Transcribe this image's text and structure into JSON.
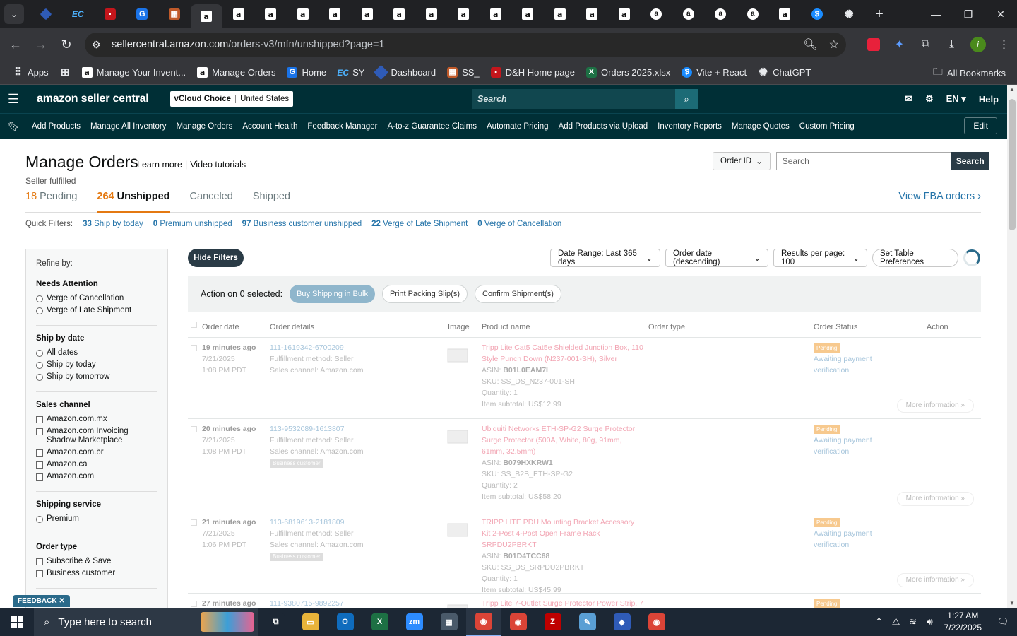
{
  "browser": {
    "tabs": [
      {
        "icon": "blue-diamond-icon"
      },
      {
        "icon": "ec-icon"
      },
      {
        "icon": "dh-icon"
      },
      {
        "icon": "g-icon"
      },
      {
        "icon": "box-icon"
      },
      {
        "icon": "amazon-icon",
        "active": true
      },
      {
        "icon": "amazon-icon"
      },
      {
        "icon": "amazon-icon"
      },
      {
        "icon": "amazon-icon"
      },
      {
        "icon": "amazon-icon"
      },
      {
        "icon": "amazon-icon"
      },
      {
        "icon": "amazon-icon"
      },
      {
        "icon": "amazon-icon"
      },
      {
        "icon": "amazon-icon"
      },
      {
        "icon": "amazon-icon"
      },
      {
        "icon": "amazon-icon"
      },
      {
        "icon": "amazon-icon"
      },
      {
        "icon": "amazon-icon"
      },
      {
        "icon": "amazon-icon"
      },
      {
        "icon": "amazon-circle-icon"
      },
      {
        "icon": "amazon-circle-icon"
      },
      {
        "icon": "amazon-circle-icon"
      },
      {
        "icon": "amazon-circle-icon"
      },
      {
        "icon": "amazon-icon"
      },
      {
        "icon": "s-icon"
      },
      {
        "icon": "chatgpt-icon"
      }
    ],
    "url_domain": "sellercentral.amazon.com",
    "url_path": "/orders-v3/mfn/unshipped?page=1",
    "bookmarks": [
      {
        "label": "Apps",
        "icon": "apps-grid-icon"
      },
      {
        "label": "",
        "icon": "tab-groups-icon"
      },
      {
        "label": "Manage Your Invent...",
        "icon": "amazon-icon"
      },
      {
        "label": "Manage Orders",
        "icon": "amazon-icon"
      },
      {
        "label": "Home",
        "icon": "g-icon"
      },
      {
        "label": "SY",
        "icon": "ec-icon"
      },
      {
        "label": "Dashboard",
        "icon": "blue-diamond-icon"
      },
      {
        "label": "SS_",
        "icon": "box-icon"
      },
      {
        "label": "D&H Home page",
        "icon": "dh-icon"
      },
      {
        "label": "Orders 2025.xlsx",
        "icon": "excel-icon"
      },
      {
        "label": "Vite + React",
        "icon": "s-icon"
      },
      {
        "label": "ChatGPT",
        "icon": "chatgpt-icon"
      }
    ],
    "all_bookmarks": "All Bookmarks",
    "profile_initial": "i"
  },
  "header": {
    "logo": "amazon seller central",
    "account": "vCloud Choice",
    "country": "United States",
    "search_placeholder": "Search",
    "lang": "EN",
    "help": "Help"
  },
  "nav": {
    "links": [
      "Add Products",
      "Manage All Inventory",
      "Manage Orders",
      "Account Health",
      "Feedback Manager",
      "A-to-z Guarantee Claims",
      "Automate Pricing",
      "Add Products via Upload",
      "Inventory Reports",
      "Manage Quotes",
      "Custom Pricing"
    ],
    "edit": "Edit"
  },
  "page": {
    "title": "Manage Orders",
    "learn_more": "Learn more",
    "video_tutorials": "Video tutorials",
    "subtitle": "Seller fulfilled",
    "search_type": "Order ID",
    "search_placeholder": "Search",
    "search_button": "Search",
    "tabs": [
      {
        "count": "18",
        "label": "Pending"
      },
      {
        "count": "264",
        "label": "Unshipped",
        "selected": true
      },
      {
        "count": "",
        "label": "Canceled"
      },
      {
        "count": "",
        "label": "Shipped"
      }
    ],
    "fba_link": "View FBA orders ›",
    "quick_filters_label": "Quick Filters:",
    "quick_filters": [
      {
        "count": "33",
        "label": "Ship by today"
      },
      {
        "count": "0",
        "label": "Premium unshipped"
      },
      {
        "count": "97",
        "label": "Business customer unshipped"
      },
      {
        "count": "22",
        "label": "Verge of Late Shipment"
      },
      {
        "count": "0",
        "label": "Verge of Cancellation"
      }
    ]
  },
  "sidebar": {
    "refine_by": "Refine by:",
    "groups": [
      {
        "title": "Needs Attention",
        "type": "radio",
        "options": [
          "Verge of Cancellation",
          "Verge of Late Shipment"
        ]
      },
      {
        "title": "Ship by date",
        "type": "radio",
        "options": [
          "All dates",
          "Ship by today",
          "Ship by tomorrow"
        ]
      },
      {
        "title": "Sales channel",
        "type": "checkbox",
        "options": [
          "Amazon.com.mx",
          "Amazon.com Invoicing Shadow Marketplace",
          "Amazon.com.br",
          "Amazon.ca",
          "Amazon.com"
        ]
      },
      {
        "title": "Shipping service",
        "type": "radio",
        "options": [
          "Premium"
        ]
      },
      {
        "title": "Order type",
        "type": "checkbox",
        "options": [
          "Subscribe & Save",
          "Business customer"
        ]
      }
    ]
  },
  "controls": {
    "hide_filters": "Hide Filters",
    "date_range": "Date Range: Last 365 days",
    "sort": "Order date (descending)",
    "per_page": "Results per page: 100",
    "table_prefs": "Set Table Preferences",
    "action_label": "Action on 0 selected:",
    "buy_shipping": "Buy Shipping in Bulk",
    "print_slips": "Print Packing Slip(s)",
    "confirm_shipment": "Confirm Shipment(s)"
  },
  "table": {
    "headers": [
      "Order date",
      "Order details",
      "Image",
      "Product name",
      "Order type",
      "Order Status",
      "Action"
    ],
    "rows": [
      {
        "age": "19 minutes ago",
        "date": "7/21/2025",
        "time": "1:08 PM PDT",
        "order_id": "111-1619342-6700209",
        "fulfillment": "Fulfillment method: Seller",
        "channel": "Sales channel: Amazon.com",
        "business": "",
        "product": "Tripp Lite Cat5 Cat5e Shielded Junction Box, 110 Style Punch Down (N237-001-SH), Silver",
        "asin": "B01L0EAM7I",
        "sku": "SS_DS_N237-001-SH",
        "qty": "1",
        "subtotal": "US$12.99",
        "status": "Pending",
        "status_note": "Awaiting payment verification",
        "more": "More information »"
      },
      {
        "age": "20 minutes ago",
        "date": "7/21/2025",
        "time": "1:08 PM PDT",
        "order_id": "113-9532089-1613807",
        "fulfillment": "Fulfillment method: Seller",
        "channel": "Sales channel: Amazon.com",
        "business": "Business customer",
        "product": "Ubiquiti Networks ETH-SP-G2 Surge Protector Surge Protector (500A, White, 80g, 91mm, 61mm, 32.5mm)",
        "asin": "B079HXKRW1",
        "sku": "SS_B2B_ETH-SP-G2",
        "qty": "2",
        "subtotal": "US$58.20",
        "status": "Pending",
        "status_note": "Awaiting payment verification",
        "more": "More information »"
      },
      {
        "age": "21 minutes ago",
        "date": "7/21/2025",
        "time": "1:06 PM PDT",
        "order_id": "113-6819613-2181809",
        "fulfillment": "Fulfillment method: Seller",
        "channel": "Sales channel: Amazon.com",
        "business": "Business customer",
        "product": "TRIPP LITE PDU Mounting Bracket Accessory Kit 2-Post 4-Post Open Frame Rack SRPDU2PBRKT",
        "asin": "B01D4TCC68",
        "sku": "SS_DS_SRPDU2PBRKT",
        "qty": "1",
        "subtotal": "US$45.99",
        "status": "Pending",
        "status_note": "Awaiting payment verification",
        "more": "More information »"
      },
      {
        "age": "27 minutes ago",
        "date": "",
        "time": "",
        "order_id": "111-9380715-9892257",
        "fulfillment": "",
        "channel": "",
        "business": "",
        "product": "Tripp Lite 7-Outlet Surge Protector Power Strip, 7",
        "asin": "",
        "sku": "",
        "qty": "",
        "subtotal": "",
        "status": "Pending",
        "status_note": "",
        "more": ""
      }
    ]
  },
  "feedback": "FEEDBACK ✕",
  "taskbar": {
    "search_placeholder": "Type here to search",
    "apps": [
      "task-view-icon",
      "file-explorer-icon",
      "outlook-icon",
      "excel-icon",
      "zoom-icon",
      "calculator-icon",
      "chrome-icon",
      "chrome-icon",
      "filezilla-icon",
      "notepad-icon",
      "blue-diamond-icon",
      "chrome-profile-icon"
    ],
    "time": "1:27 AM",
    "date": "7/22/2025"
  },
  "colors": {
    "header_bg": "#002f36",
    "accent": "#e47911",
    "link": "#2574a9"
  }
}
